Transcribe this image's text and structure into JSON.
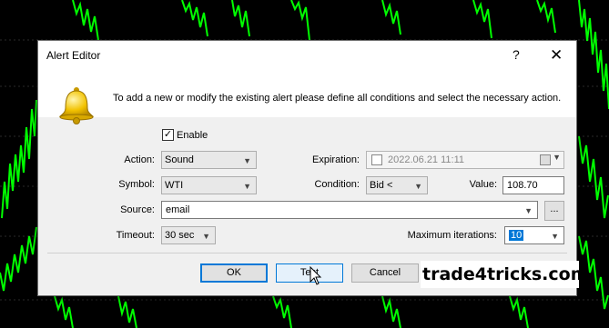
{
  "dialog": {
    "title": "Alert Editor",
    "help_glyph": "?",
    "close_glyph": "✕",
    "message": "To add a new or modify the existing alert please define all conditions and select the necessary action."
  },
  "form": {
    "enable": {
      "label": "Enable",
      "checked": true,
      "check_glyph": "✓"
    },
    "action": {
      "label": "Action:",
      "value": "Sound"
    },
    "symbol": {
      "label": "Symbol:",
      "value": "WTI"
    },
    "source": {
      "label": "Source:",
      "value": "email",
      "browse_label": "..."
    },
    "timeout": {
      "label": "Timeout:",
      "value": "30 sec"
    },
    "expiration": {
      "label": "Expiration:",
      "value": "2022.06.21 11:11"
    },
    "condition": {
      "label": "Condition:",
      "value": "Bid <"
    },
    "value": {
      "label": "Value:",
      "value": "108.70"
    },
    "max_iterations": {
      "label": "Maximum iterations:",
      "value": "10"
    }
  },
  "buttons": {
    "ok": "OK",
    "test": "Test",
    "cancel": "Cancel"
  },
  "watermark": "trade4tricks.com",
  "colors": {
    "chart_background": "#000000",
    "chart_candles": "#00ff00",
    "selection": "#0078d7"
  }
}
